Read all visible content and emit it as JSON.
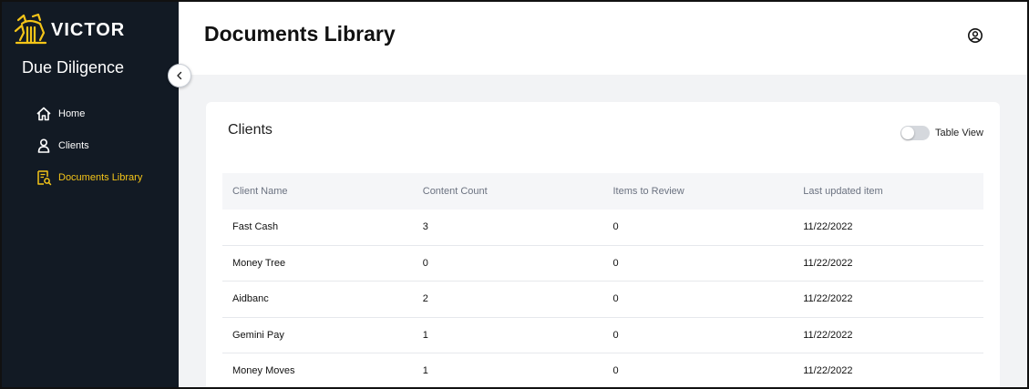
{
  "sidebar": {
    "logo_text": "VICTOR",
    "app_title": "Due Diligence",
    "items": [
      {
        "label": "Home",
        "icon": "home-icon"
      },
      {
        "label": "Clients",
        "icon": "user-icon"
      },
      {
        "label": "Documents Library",
        "icon": "document-search-icon",
        "active": true
      }
    ]
  },
  "header": {
    "title": "Documents Library"
  },
  "card": {
    "title": "Clients",
    "toggle_label": "Table View",
    "toggle_on": false
  },
  "table": {
    "columns": [
      "Client Name",
      "Content Count",
      "Items to Review",
      "Last updated item"
    ],
    "rows": [
      [
        "Fast Cash",
        "3",
        "0",
        "11/22/2022"
      ],
      [
        "Money Tree",
        "0",
        "0",
        "11/22/2022"
      ],
      [
        "Aidbanc",
        "2",
        "0",
        "11/22/2022"
      ],
      [
        "Gemini Pay",
        "1",
        "0",
        "11/22/2022"
      ],
      [
        "Money Moves",
        "1",
        "0",
        "11/22/2022"
      ]
    ]
  },
  "colors": {
    "sidebar_bg": "#121a24",
    "accent": "#f5c518",
    "main_bg": "#f2f3f5"
  }
}
